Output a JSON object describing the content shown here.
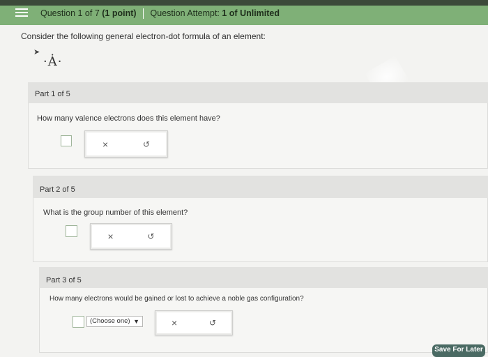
{
  "header": {
    "question_label": "Question 1 of 7",
    "points_label": "(1 point)",
    "attempt_label": "Question Attempt:",
    "attempt_value": "1 of Unlimited"
  },
  "intro_text": "Consider the following general electron-dot formula of an element:",
  "formula_text": "·Ȧ·",
  "parts": [
    {
      "label": "Part 1 of 5",
      "question": "How many valence electrons does this element have?"
    },
    {
      "label": "Part 2 of 5",
      "question": "What is the group number of this element?"
    },
    {
      "label": "Part 3 of 5",
      "question": "How many electrons would be gained or lost to achieve a noble gas configuration?",
      "select_value": "(Choose one)"
    }
  ],
  "buttons": {
    "clear_symbol": "×",
    "undo_symbol": "↺",
    "save_label": "Save For Later"
  },
  "colors": {
    "header_green": "#7fb077",
    "save_button": "#4a6a63"
  }
}
